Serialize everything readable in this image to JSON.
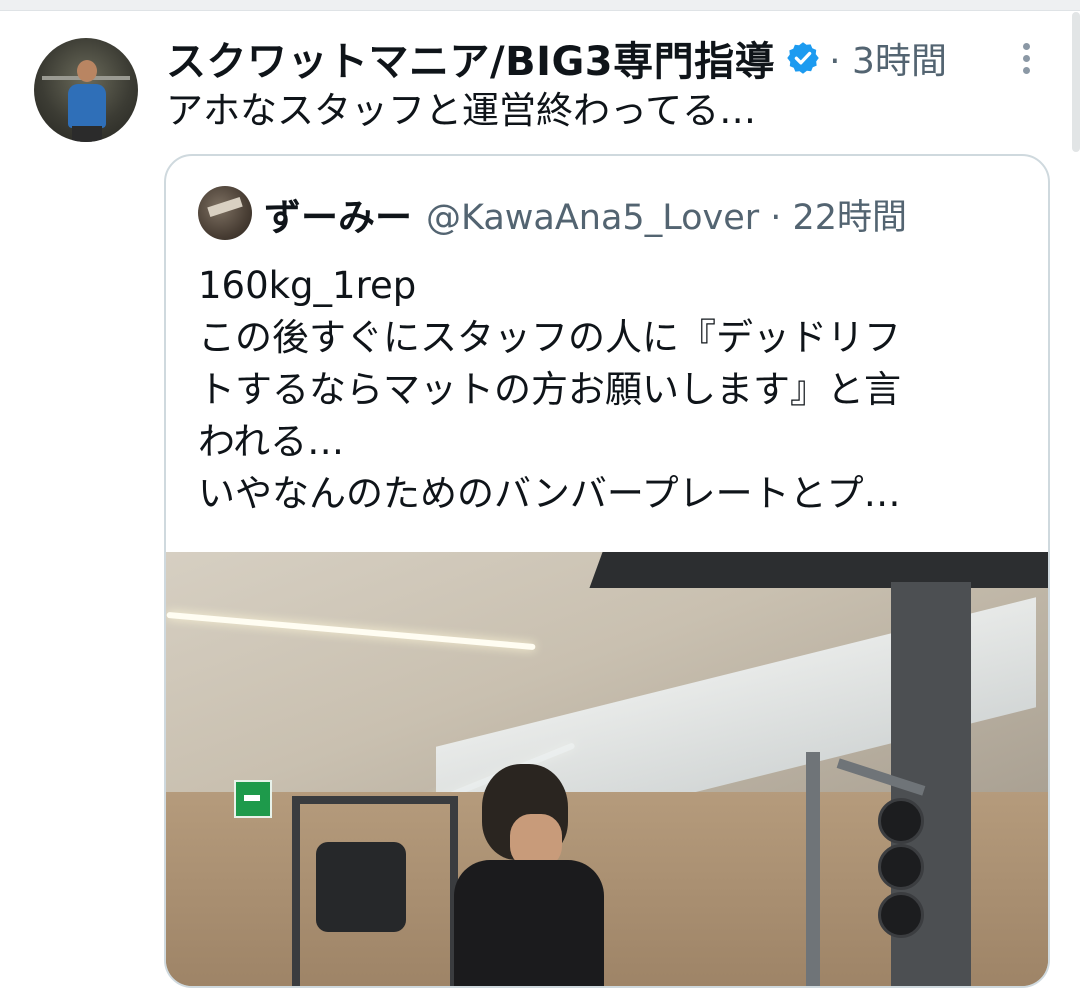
{
  "tweet": {
    "display_name": "スクワットマニア/BIG3専門指導",
    "meta": "· 3時間",
    "text": "アホなスタッフと運営終わってる…",
    "verified_icon": "verified-badge-icon",
    "accent_color": "#1d9bf0"
  },
  "quoted": {
    "display_name": "ずーみー",
    "handle_time": "@KawaAna5_Lover · 22時間",
    "lines": [
      "160kg_1rep",
      "この後すぐにスタッフの人に『デッドリフ",
      "トするならマットの方お願いします』と言",
      "われる…",
      "いやなんのためのバンバープレートとプ…"
    ]
  }
}
